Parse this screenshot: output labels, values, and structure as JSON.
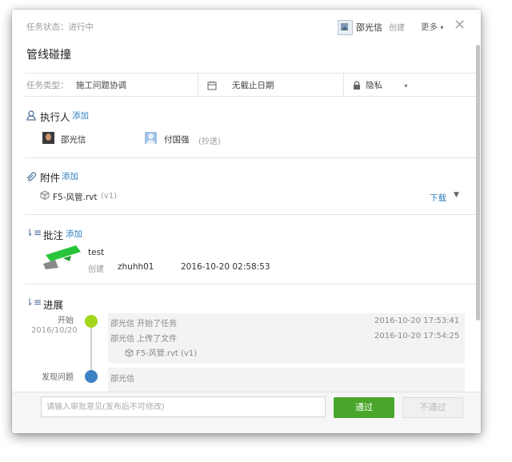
{
  "header": {
    "status_label": "任务状态：进行中",
    "creator_name": "邵光信",
    "creator_action": "创建",
    "more_label": "更多",
    "title": "管线碰撞"
  },
  "meta": {
    "type_label": "任务类型：",
    "type_value": "施工问题协调",
    "due_label": "无截止日期",
    "privacy_label": "隐私"
  },
  "executor": {
    "title": "执行人",
    "add": "添加",
    "people": [
      {
        "name": "邵光信",
        "role": ""
      },
      {
        "name": "付国强",
        "role": "(抄送)"
      }
    ]
  },
  "attachment": {
    "title": "附件",
    "add": "添加",
    "file_name": "F5-风管.rvt",
    "version": "(v1)",
    "download": "下载"
  },
  "annotation": {
    "title": "批注",
    "add": "添加",
    "item_title": "test",
    "action": "创建",
    "user": "zhuhh01",
    "time": "2016-10-20 02:58:53"
  },
  "progress": {
    "title": "进展",
    "stage1": "开始",
    "stage1_date": "2016/10/20",
    "entries": [
      {
        "text": "邵光信 开始了任务",
        "time": "2016-10-20 17:53:41"
      },
      {
        "text": "邵光信 上传了文件",
        "time": "2016-10-20 17:54:25"
      }
    ],
    "file": "F5-风管.rvt (v1)",
    "stage2": "发现问题",
    "stage2_text": "邵光信"
  },
  "footer": {
    "input_placeholder": "请输入审批意见(发布后不可修改)",
    "pass": "通过",
    "reject": "不通过"
  },
  "colors": {
    "accent_green": "#4aa62b",
    "link_blue": "#2f7fc1",
    "dot_start": "#a3d61a",
    "dot_issue": "#3b82c4"
  }
}
